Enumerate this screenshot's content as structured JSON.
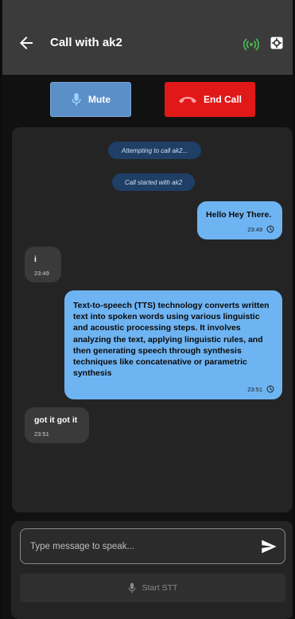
{
  "header": {
    "back_icon": "back-arrow-icon",
    "title": "Call with ak2",
    "status_icon": "signal-broadcast-icon",
    "status_color": "#4caf50",
    "settings_icon": "gear-icon"
  },
  "controls": {
    "mute_label": "Mute",
    "mute_icon": "microphone-icon",
    "end_call_label": "End Call",
    "end_call_icon": "phone-hangup-icon"
  },
  "messages": {
    "system": [
      "Attempting to call ak2...",
      "Call started with ak2"
    ],
    "m1": {
      "text": "Hello Hey There.",
      "time": "23:49",
      "direction": "outgoing"
    },
    "m2": {
      "text": "i",
      "time": "23:49",
      "direction": "incoming"
    },
    "m3": {
      "text": "Text-to-speech (TTS) technology converts written text into spoken words using various linguistic and acoustic processing steps. It involves analyzing the text, applying linguistic rules, and then generating speech through synthesis techniques like concatenative or parametric synthesis",
      "time": "23:51",
      "direction": "outgoing"
    },
    "m4": {
      "text": "got it got it",
      "time": "23:51",
      "direction": "incoming"
    }
  },
  "composer": {
    "placeholder": "Type message to speak...",
    "value": "",
    "send_icon": "send-icon",
    "stt_label": "Start STT",
    "stt_icon": "microphone-icon"
  },
  "colors": {
    "outgoing_bubble": "#6fb4f2",
    "incoming_bubble": "#3a3a3a",
    "mute_button": "#5b8fc8",
    "end_call_button": "#e01818",
    "system_pill": "#1f3f66"
  }
}
